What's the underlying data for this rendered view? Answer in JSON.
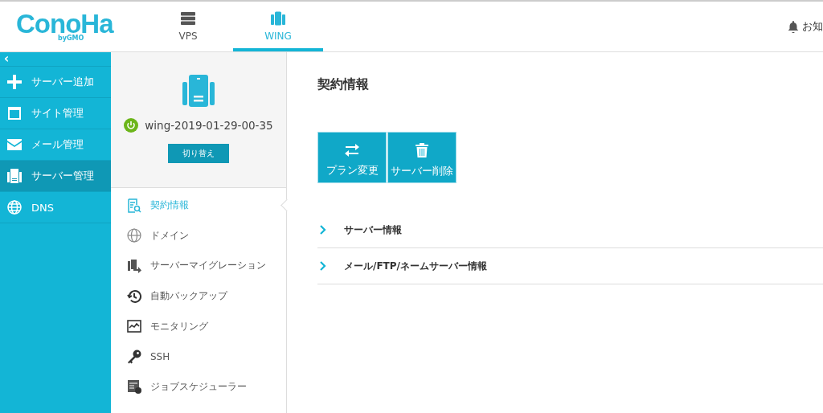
{
  "logo": {
    "name": "ConoHa",
    "byline": "byGMO"
  },
  "tabs": [
    {
      "label": "VPS",
      "selected": false
    },
    {
      "label": "WING",
      "selected": true
    }
  ],
  "notice": {
    "label": "お知"
  },
  "sidebar": {
    "collapse": "‹",
    "items": [
      {
        "label": "サーバー追加",
        "selected": false
      },
      {
        "label": "サイト管理",
        "selected": false
      },
      {
        "label": "メール管理",
        "selected": false
      },
      {
        "label": "サーバー管理",
        "selected": true
      },
      {
        "label": "DNS",
        "selected": false
      }
    ]
  },
  "server": {
    "name": "wing-2019-01-29-00-35",
    "running": true,
    "switch_button": "切り替え"
  },
  "submenu": [
    {
      "label": "契約情報",
      "selected": true
    },
    {
      "label": "ドメイン",
      "selected": false
    },
    {
      "label": "サーバーマイグレーション",
      "selected": false
    },
    {
      "label": "自動バックアップ",
      "selected": false
    },
    {
      "label": "モニタリング",
      "selected": false
    },
    {
      "label": "SSH",
      "selected": false
    },
    {
      "label": "ジョブスケジューラー",
      "selected": false
    }
  ],
  "content": {
    "title": "契約情報",
    "actions": [
      "プラン変更",
      "サーバー削除"
    ],
    "sections": [
      {
        "label": "サーバー情報",
        "expanded": false
      },
      {
        "label": "メール/FTP/ネームサーバー情報",
        "expanded": false
      }
    ]
  }
}
